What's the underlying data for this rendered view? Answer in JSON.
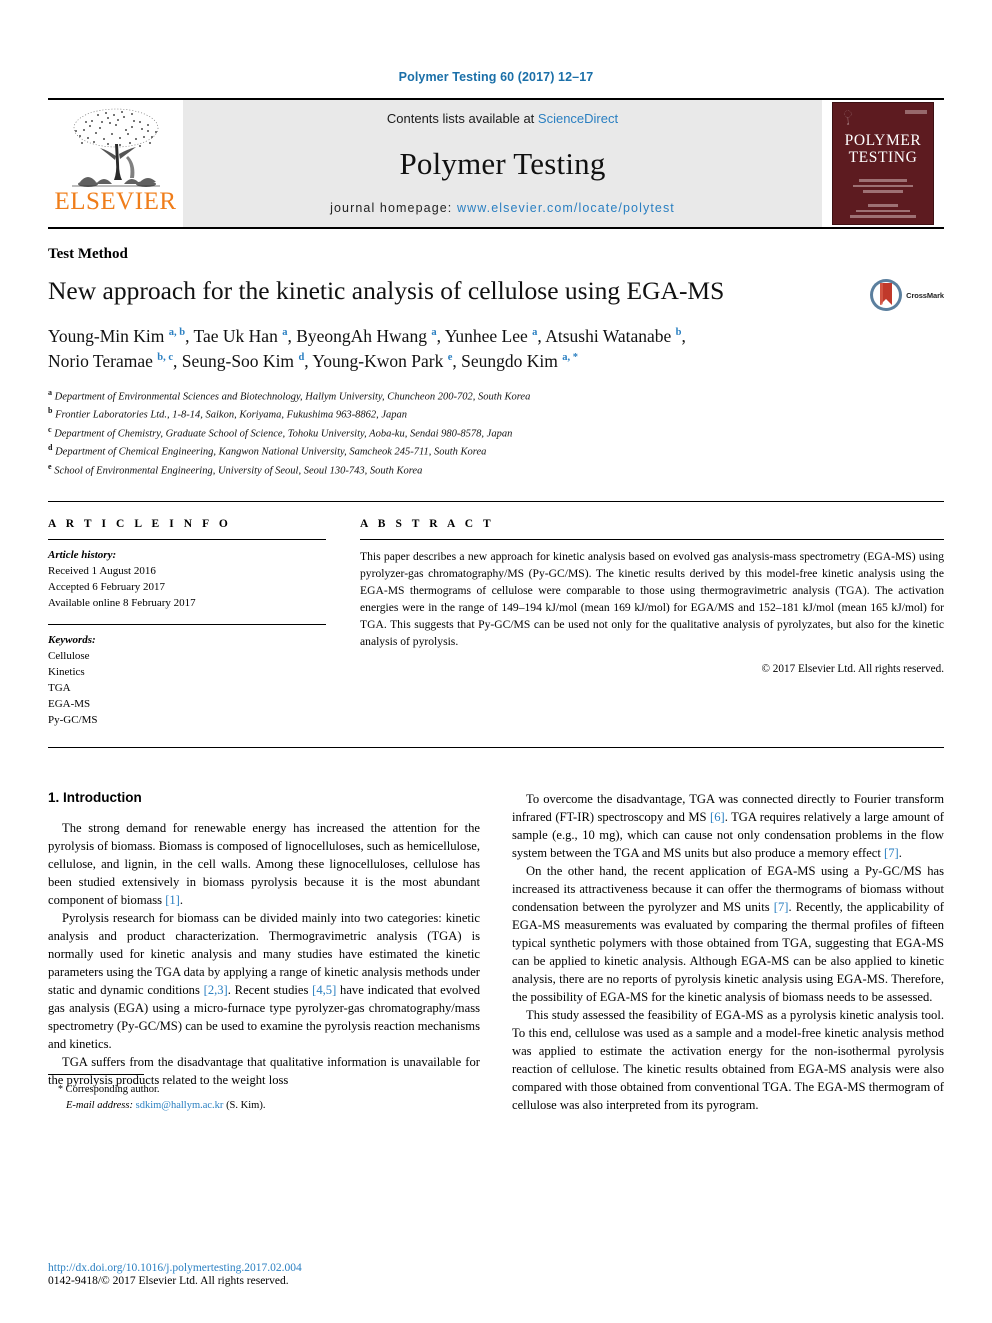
{
  "running_head": "Polymer Testing 60 (2017) 12–17",
  "masthead": {
    "publisher_name": "ELSEVIER",
    "contents_prefix": "Contents lists available at ",
    "contents_link": "ScienceDirect",
    "journal_title": "Polymer Testing",
    "homepage_prefix": "journal homepage: ",
    "homepage_link": "www.elsevier.com/locate/polytest",
    "cover_title_line1": "POLYMER",
    "cover_title_line2": "TESTING"
  },
  "article": {
    "section_label": "Test Method",
    "title": "New approach for the kinetic analysis of cellulose using EGA-MS",
    "crossmark_label": "CrossMark",
    "authors": [
      {
        "name": "Young-Min Kim",
        "marks": "a, b",
        "sep": ", "
      },
      {
        "name": "Tae Uk Han",
        "marks": "a",
        "sep": ", "
      },
      {
        "name": "ByeongAh Hwang",
        "marks": "a",
        "sep": ", "
      },
      {
        "name": "Yunhee Lee",
        "marks": "a",
        "sep": ", "
      },
      {
        "name": "Atsushi Watanabe",
        "marks": "b",
        "sep": ", "
      },
      {
        "name": "Norio Teramae",
        "marks": "b, c",
        "sep": ", "
      },
      {
        "name": "Seung-Soo Kim",
        "marks": "d",
        "sep": ", "
      },
      {
        "name": "Young-Kwon Park",
        "marks": "e",
        "sep": ", "
      },
      {
        "name": "Seungdo Kim",
        "marks": "a, *",
        "sep": ""
      }
    ],
    "affiliations": [
      {
        "mark": "a",
        "text": "Department of Environmental Sciences and Biotechnology, Hallym University, Chuncheon 200-702, South Korea"
      },
      {
        "mark": "b",
        "text": "Frontier Laboratories Ltd., 1-8-14, Saikon, Koriyama, Fukushima 963-8862, Japan"
      },
      {
        "mark": "c",
        "text": "Department of Chemistry, Graduate School of Science, Tohoku University, Aoba-ku, Sendai 980-8578, Japan"
      },
      {
        "mark": "d",
        "text": "Department of Chemical Engineering, Kangwon National University, Samcheok 245-711, South Korea"
      },
      {
        "mark": "e",
        "text": "School of Environmental Engineering, University of Seoul, Seoul 130-743, South Korea"
      }
    ]
  },
  "article_info": {
    "heading": "A R T I C L E  I N F O",
    "history_label": "Article history:",
    "history": [
      "Received 1 August 2016",
      "Accepted 6 February 2017",
      "Available online 8 February 2017"
    ],
    "keywords_label": "Keywords:",
    "keywords": [
      "Cellulose",
      "Kinetics",
      "TGA",
      "EGA-MS",
      "Py-GC/MS"
    ]
  },
  "abstract": {
    "heading": "A B S T R A C T",
    "text": "This paper describes a new approach for kinetic analysis based on evolved gas analysis-mass spectrometry (EGA-MS) using pyrolyzer-gas chromatography/MS (Py-GC/MS). The kinetic results derived by this model-free kinetic analysis using the EGA-MS thermograms of cellulose were comparable to those using thermogravimetric analysis (TGA). The activation energies were in the range of 149–194 kJ/mol (mean 169 kJ/mol) for EGA/MS and 152–181 kJ/mol (mean 165 kJ/mol) for TGA. This suggests that Py-GC/MS can be used not only for the qualitative analysis of pyrolyzates, but also for the kinetic analysis of pyrolysis.",
    "copyright": "© 2017 Elsevier Ltd. All rights reserved."
  },
  "body": {
    "section_title": "1.  Introduction",
    "left_paragraphs": [
      {
        "pre": "The strong demand for renewable energy has increased the attention for the pyrolysis of biomass. Biomass is composed of lignocelluloses, such as hemicellulose, cellulose, and lignin, in the cell walls. Among these lignocelluloses, cellulose has been studied extensively in biomass pyrolysis because it is the most abundant component of biomass ",
        "cite": "[1]",
        "post": "."
      },
      {
        "pre": "Pyrolysis research for biomass can be divided mainly into two categories: kinetic analysis and product characterization. Thermogravimetric analysis (TGA) is normally used for kinetic analysis and many studies have estimated the kinetic parameters using the TGA data by applying a range of kinetic analysis methods under static and dynamic conditions ",
        "cite": "[2,3]",
        "mid": ". Recent studies ",
        "cite2": "[4,5]",
        "post": " have indicated that evolved gas analysis (EGA) using a micro-furnace type pyrolyzer-gas chromatography/mass spectrometry (Py-GC/MS) can be used to examine the pyrolysis reaction mechanisms and kinetics."
      },
      {
        "pre": "TGA suffers from the disadvantage that qualitative information is unavailable for the pyrolysis products related to the weight loss",
        "post": ""
      }
    ],
    "right_paragraphs": [
      {
        "pre": "To overcome the disadvantage, TGA was connected directly to Fourier transform infrared (FT-IR) spectroscopy and MS ",
        "cite": "[6]",
        "mid": ". TGA requires relatively a large amount of sample (e.g., 10 mg), which can cause not only condensation problems in the flow system between the TGA and MS units but also produce a memory effect ",
        "cite2": "[7]",
        "post": "."
      },
      {
        "pre": "On the other hand, the recent application of EGA-MS using a Py-GC/MS has increased its attractiveness because it can offer the thermograms of biomass without condensation between the pyrolyzer and MS units ",
        "cite": "[7]",
        "post": ". Recently, the applicability of EGA-MS measurements was evaluated by comparing the thermal profiles of fifteen typical synthetic polymers with those obtained from TGA, suggesting that EGA-MS can be applied to kinetic analysis. Although EGA-MS can be also applied to kinetic analysis, there are no reports of pyrolysis kinetic analysis using EGA-MS. Therefore, the possibility of EGA-MS for the kinetic analysis of biomass needs to be assessed."
      },
      {
        "pre": "This study assessed the feasibility of EGA-MS as a pyrolysis kinetic analysis tool. To this end, cellulose was used as a sample and a model-free kinetic analysis method was applied to estimate the activation energy for the non-isothermal pyrolysis reaction of cellulose. The kinetic results obtained from EGA-MS analysis were also compared with those obtained from conventional TGA. The EGA-MS thermogram of cellulose was also interpreted from its pyrogram.",
        "post": ""
      }
    ]
  },
  "footnote": {
    "star": "*",
    "corresponding": " Corresponding author.",
    "email_label": "E-mail address:",
    "email": "sdkim@hallym.ac.kr",
    "email_suffix": " (S. Kim)."
  },
  "page_footer": {
    "doi": "http://dx.doi.org/10.1016/j.polymertesting.2017.02.004",
    "issn": "0142-9418/© 2017 Elsevier Ltd. All rights reserved."
  },
  "colors": {
    "link": "#2a7fc1",
    "elsevier_orange": "#ef7d1a",
    "cover_maroon": "#5d1b20",
    "crossmark_red": "#c0392b",
    "crossmark_ring": "#5b7f9e"
  }
}
